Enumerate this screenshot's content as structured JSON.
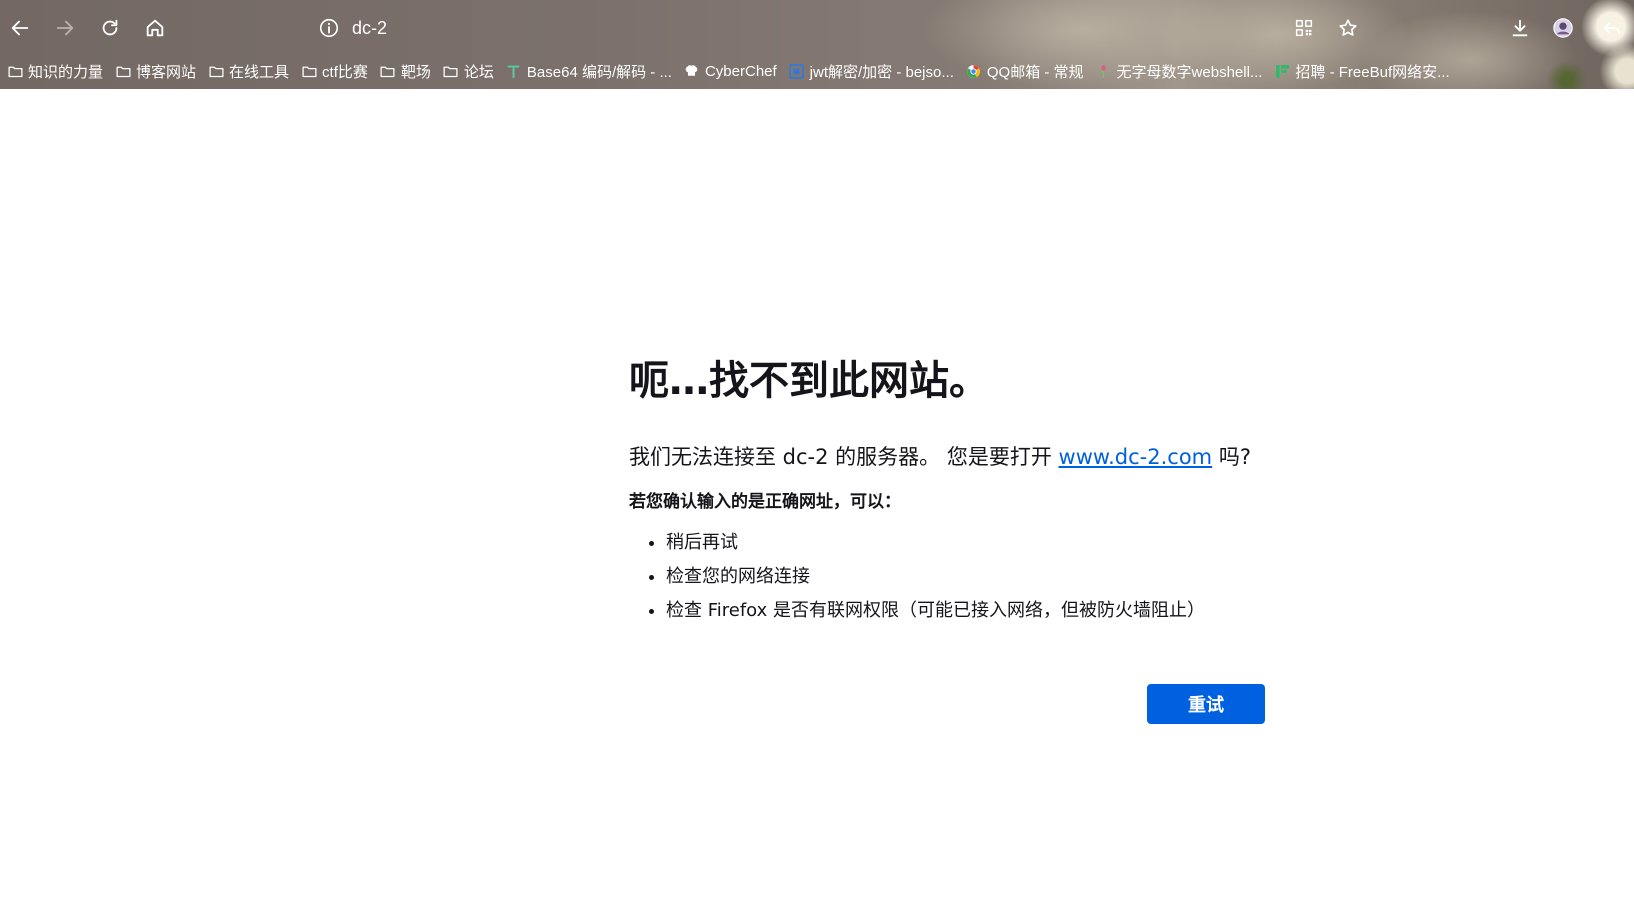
{
  "browser": {
    "url": "dc-2",
    "toolbar_colors": {
      "icon": "#ffffff",
      "icon_disabled": "#b8b2ad"
    }
  },
  "bookmarks": [
    {
      "icon": "folder-icon",
      "label": "知识的力量"
    },
    {
      "icon": "folder-icon",
      "label": "博客网站"
    },
    {
      "icon": "folder-icon",
      "label": "在线工具"
    },
    {
      "icon": "folder-icon",
      "label": "ctf比赛"
    },
    {
      "icon": "folder-icon",
      "label": "靶场"
    },
    {
      "icon": "folder-icon",
      "label": "论坛"
    },
    {
      "icon": "t-favicon-icon",
      "label": "Base64 编码/解码 - ..."
    },
    {
      "icon": "chef-hat-icon",
      "label": "CyberChef"
    },
    {
      "icon": "jwt-favicon-icon",
      "label": "jwt解密/加密 - bejso..."
    },
    {
      "icon": "qq-mail-icon",
      "label": "QQ邮箱 - 常规"
    },
    {
      "icon": "plant-favicon-icon",
      "label": "无字母数字webshell..."
    },
    {
      "icon": "freebuf-favicon-icon",
      "label": "招聘 - FreeBuf网络安..."
    }
  ],
  "error": {
    "title": "呃…找不到此网站。",
    "description_prefix": "我们无法连接至 dc-2 的服务器。 您是要打开 ",
    "suggested_url": "www.dc-2.com",
    "description_suffix": " 吗?",
    "heading": "若您确认输入的是正确网址，可以：",
    "suggestions": [
      "稍后再试",
      "检查您的网络连接",
      "检查 Firefox 是否有联网权限（可能已接入网络，但被防火墙阻止）"
    ],
    "retry_label": "重试"
  },
  "colors": {
    "accent": "#0061e0",
    "text": "#15141a"
  }
}
